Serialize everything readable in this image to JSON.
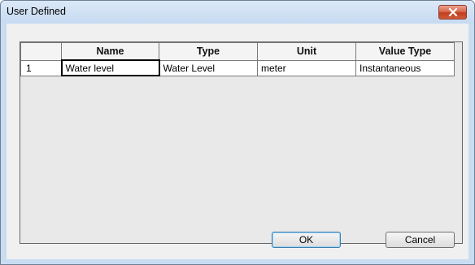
{
  "window": {
    "title": "User Defined"
  },
  "grid": {
    "columns": [
      "",
      "Name",
      "Type",
      "Unit",
      "Value Type"
    ],
    "rows": [
      [
        "1",
        "Water level",
        "Water Level",
        "meter",
        "Instantaneous"
      ]
    ]
  },
  "buttons": {
    "ok": "OK",
    "cancel": "Cancel"
  },
  "icons": {
    "close": "close-x-icon"
  },
  "colors": {
    "titlebar": "#c6daf1",
    "close": "#c23c1d",
    "client": "#f0f0f0"
  }
}
